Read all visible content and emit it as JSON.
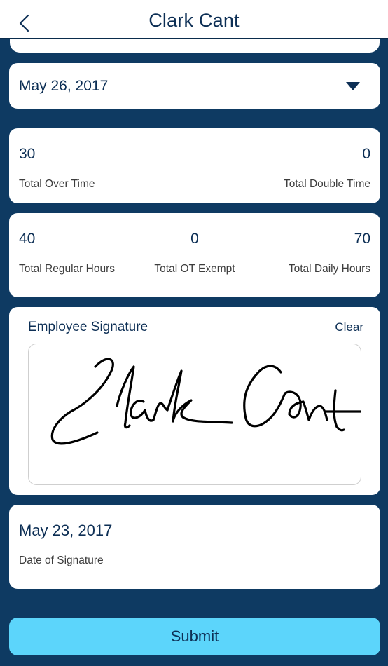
{
  "header": {
    "title": "Clark Cant",
    "back_icon": "chevron-left-icon"
  },
  "date_select": {
    "value": "May 26, 2017",
    "icon": "caret-down-icon"
  },
  "overtime_card": {
    "over_time_value": "30",
    "over_time_label": "Total Over Time",
    "double_time_value": "0",
    "double_time_label": "Total Double Time"
  },
  "hours_card": {
    "regular_value": "40",
    "regular_label": "Total Regular Hours",
    "ot_exempt_value": "0",
    "ot_exempt_label": "Total OT Exempt",
    "daily_value": "70",
    "daily_label": "Total Daily Hours"
  },
  "signature": {
    "title": "Employee Signature",
    "clear_label": "Clear",
    "signed_name": "Clark Cant"
  },
  "signature_date": {
    "value": "May 23, 2017",
    "label": "Date of Signature"
  },
  "submit_label": "Submit",
  "colors": {
    "background": "#0e3a62",
    "card": "#ffffff",
    "text_primary": "#0d2f55",
    "text_label": "#3d3d3d",
    "submit_button": "#5cd5fb"
  }
}
